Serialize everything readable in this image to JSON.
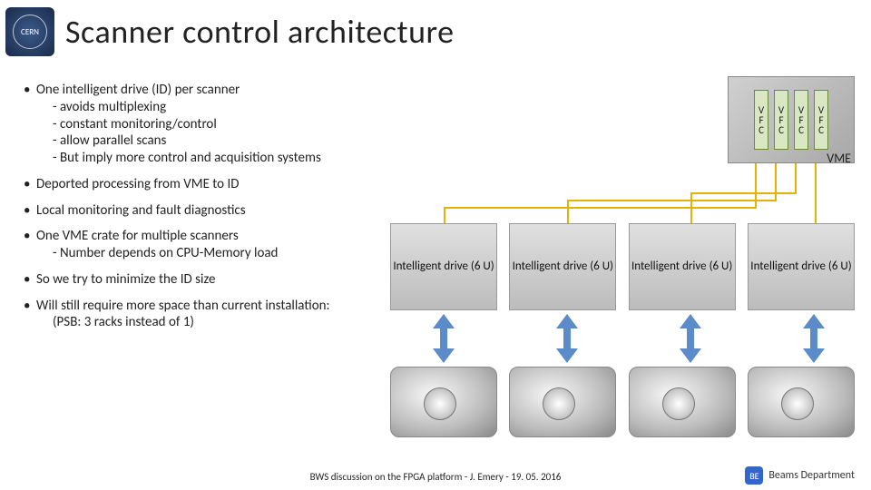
{
  "header": {
    "logo_text": "CERN",
    "title": "Scanner control architecture"
  },
  "bullets": [
    {
      "text": "One intelligent drive (ID) per scanner",
      "subs": [
        "- avoids multiplexing",
        "- constant monitoring/control",
        "- allow parallel scans",
        "- But imply more control and acquisition systems"
      ]
    },
    {
      "text": "Deported processing from VME to ID",
      "subs": []
    },
    {
      "text": "Local monitoring and fault diagnostics",
      "subs": []
    },
    {
      "text": "One VME crate for multiple scanners",
      "subs": [
        "- Number depends on CPU-Memory load"
      ]
    },
    {
      "text": "So we try to minimize the ID size",
      "subs": []
    },
    {
      "text": "Will still require more space than current installation:",
      "subs": [
        "(PSB: 3 racks instead of 1)"
      ]
    }
  ],
  "vme": {
    "slot_label_lines": [
      "V",
      "F",
      "C"
    ],
    "slot_count": 4,
    "label": "VME"
  },
  "drives": {
    "count": 4,
    "label": "Intelligent drive (6 U)"
  },
  "footer": {
    "text": "BWS discussion on the FPGA platform - J. Emery - 19. 05. 2016",
    "dept_badge": "BE",
    "dept_label": "Beams Department"
  },
  "colors": {
    "connector": "#e8b000",
    "arrow": "#5b8bc9"
  }
}
